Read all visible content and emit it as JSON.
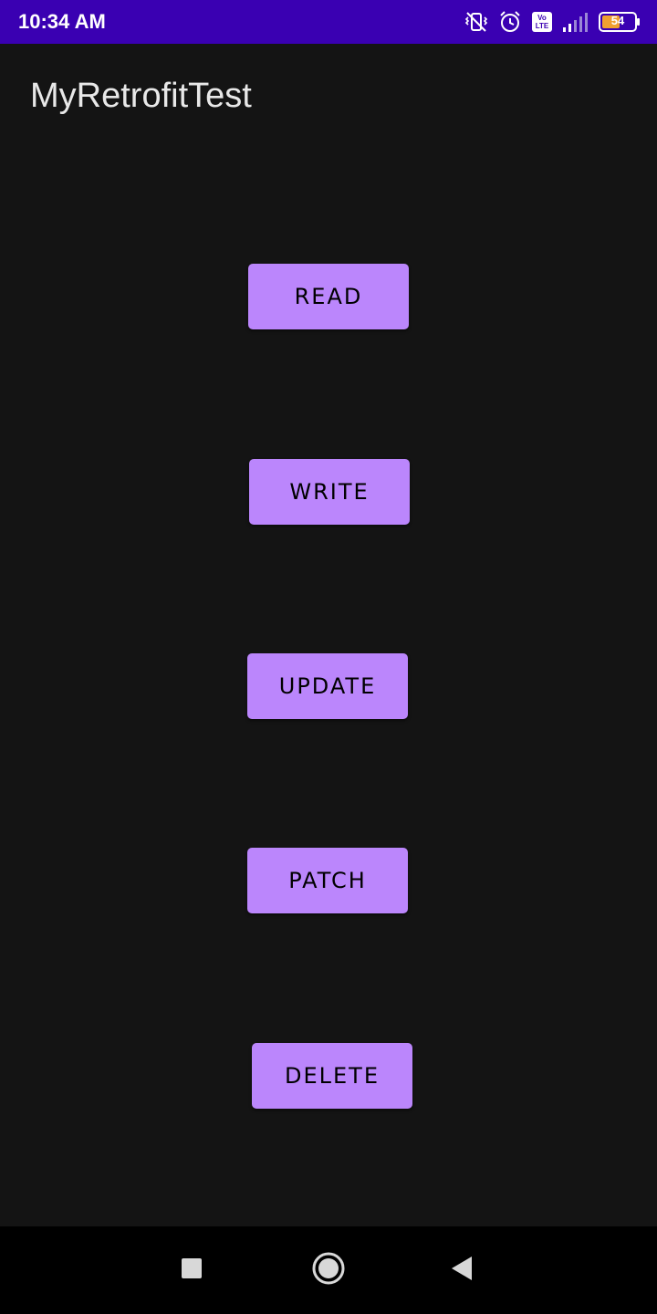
{
  "status_bar": {
    "time": "10:34 AM",
    "battery": "54",
    "icons": [
      "vibrate-off-icon",
      "alarm-icon",
      "volte-icon",
      "signal-icon",
      "battery-icon"
    ],
    "background_color": "#3a00b2"
  },
  "app": {
    "title": "MyRetrofitTest",
    "background_color": "#141414"
  },
  "buttons": {
    "read": "READ",
    "write": "WRITE",
    "update": "UPDATE",
    "patch": "PATCH",
    "delete": "DELETE",
    "color": "#bb86fc"
  },
  "nav_bar": {
    "icons": [
      "recents-icon",
      "home-icon",
      "back-icon"
    ]
  }
}
